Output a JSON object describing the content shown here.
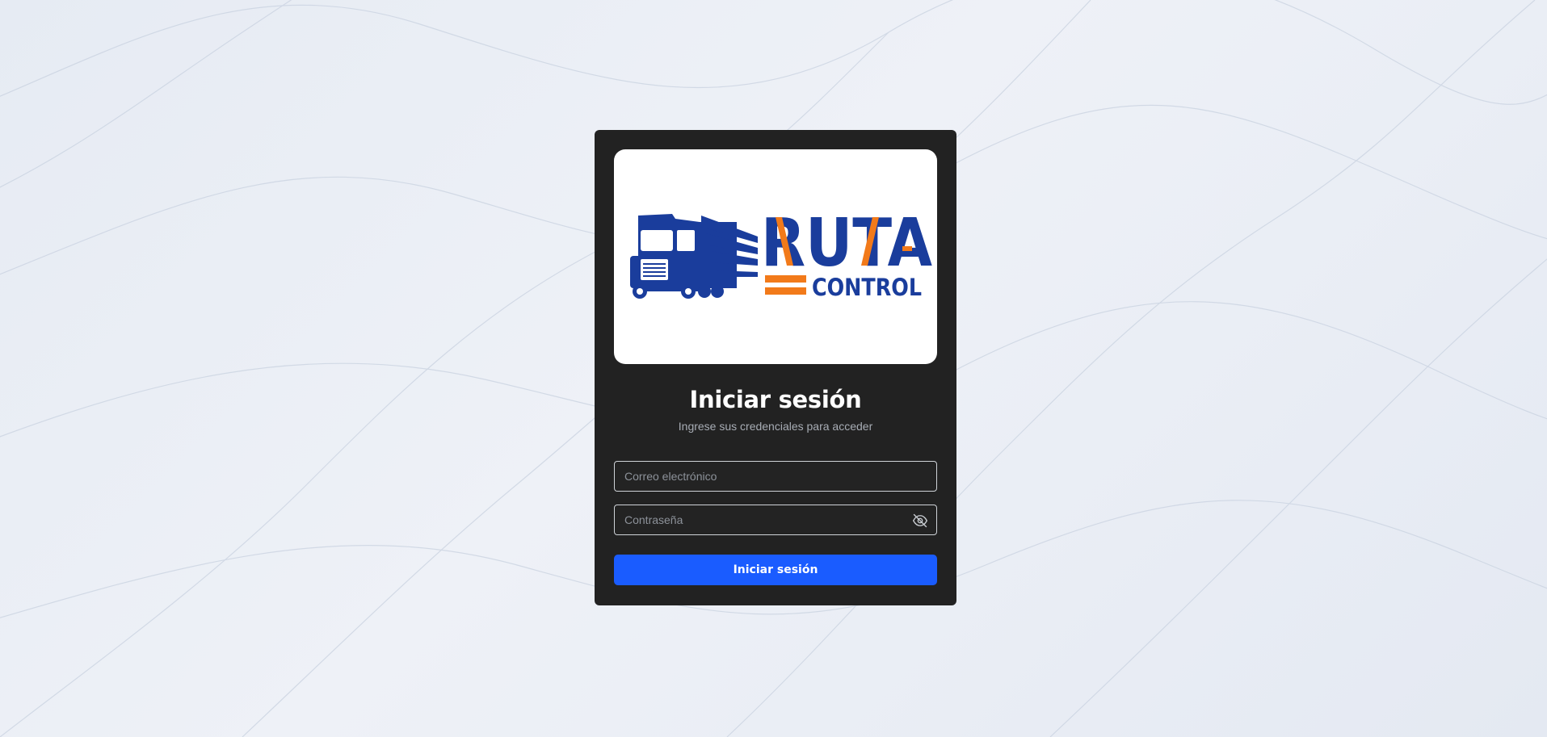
{
  "logo": {
    "brand_top": "RUTA",
    "brand_bottom": "CONTROL",
    "colors": {
      "blue": "#1a3d9c",
      "orange": "#f27a1a"
    }
  },
  "login": {
    "title": "Iniciar sesión",
    "subtitle": "Ingrese sus credenciales para acceder",
    "email_placeholder": "Correo electrónico",
    "email_value": "",
    "password_placeholder": "Contraseña",
    "password_value": "",
    "password_toggle_icon": "eye-off-icon",
    "submit_label": "Iniciar sesión"
  },
  "theme": {
    "card_bg": "#222222",
    "accent": "#1a5cff",
    "page_bg": "#e9edf5"
  }
}
